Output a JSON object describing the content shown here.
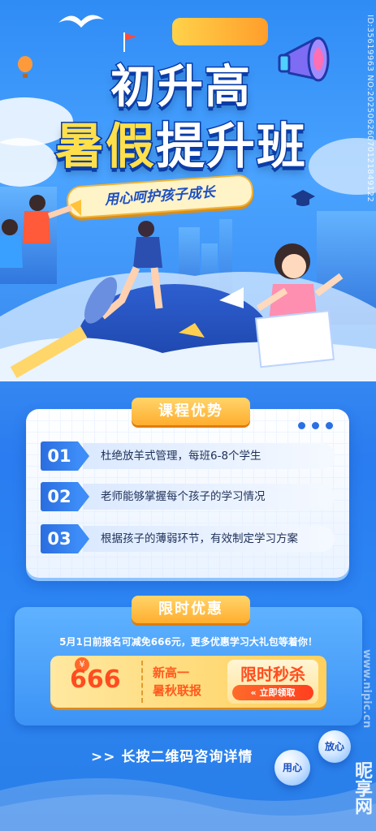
{
  "hero": {
    "title_line1": "初升高",
    "title_line2_a": "暑假",
    "title_line2_b": "提升班",
    "ribbon": "用心呵护孩子成长"
  },
  "advantages": {
    "tab": "课程优势",
    "items": [
      {
        "num": "01",
        "text": "杜绝放羊式管理，每班6-8个学生"
      },
      {
        "num": "02",
        "text": "老师能够掌握每个孩子的学习情况"
      },
      {
        "num": "03",
        "text": "根据孩子的薄弱环节，有效制定学习方案"
      }
    ]
  },
  "promo": {
    "tab": "限时优惠",
    "line": "5月1日前报名可减免666元，更多优惠学习大礼包等着你！",
    "coupon": {
      "yen": "¥",
      "value": "666",
      "course_line1": "新高一",
      "course_line2": "暑秋联报",
      "flash": "限时秒杀",
      "cta": "« 立即领取"
    }
  },
  "consult": ">> 长按二维码咨询详情",
  "orbs": {
    "worry_free": "放心",
    "care": "用心"
  },
  "watermark": {
    "side": "ID:35619963 NO:20250626070121849122",
    "url": "www.nipic.cn",
    "logo": "昵享网"
  },
  "colors": {
    "primary": "#2a7cf0",
    "accent": "#ffb02e",
    "title_yellow": "#ffe04a",
    "price_red": "#ff4d1f"
  }
}
